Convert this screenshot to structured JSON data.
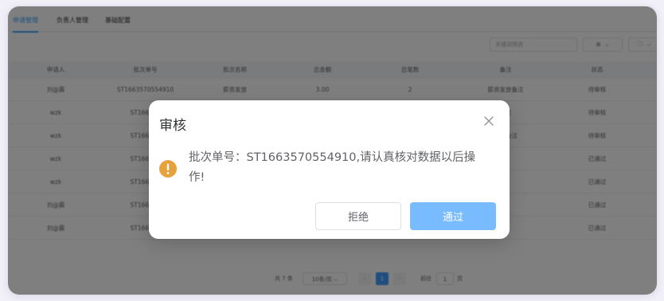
{
  "tabs": [
    "申请管理",
    "负责人管理",
    "基础配置"
  ],
  "toolbar": {
    "search_placeholder": "关键词筛选",
    "grid_icon": "⊞",
    "folder_icon": "🗀"
  },
  "table": {
    "headers": [
      "申请人",
      "批次单号",
      "批次名称",
      "总金额",
      "总笔数",
      "备注",
      "状态"
    ],
    "rows": [
      [
        "刘@震",
        "ST1663570554910",
        "薪资发放",
        "3.00",
        "2",
        "薪资发放备注",
        "待审核"
      ],
      [
        "wzk",
        "ST166356",
        "",
        "",
        "",
        "备注",
        "待审核"
      ],
      [
        "wzk",
        "ST166356",
        "",
        "",
        "",
        "发放备注",
        "待审核"
      ],
      [
        "wzk",
        "ST166270",
        "",
        "",
        "",
        "息",
        "已通过"
      ],
      [
        "wzk",
        "ST166270",
        "",
        "",
        "",
        "",
        "已通过"
      ],
      [
        "刘@震",
        "ST166269",
        "",
        "",
        "",
        "",
        "已通过"
      ],
      [
        "刘@震",
        "ST166268",
        "",
        "",
        "",
        "",
        "已通过"
      ]
    ]
  },
  "pagination": {
    "total": "共 7 条",
    "page_size": "10条/页",
    "current": "1",
    "goto_label": "前往",
    "goto_value": "1",
    "page_unit": "页"
  },
  "dialog": {
    "title": "审核",
    "message": "批次单号：ST1663570554910,请认真核对数据以后操作!",
    "reject_label": "拒绝",
    "pass_label": "通过"
  },
  "colors": {
    "primary": "#409eff",
    "pass_button": "#79bbff",
    "warning": "#e6a23c"
  }
}
